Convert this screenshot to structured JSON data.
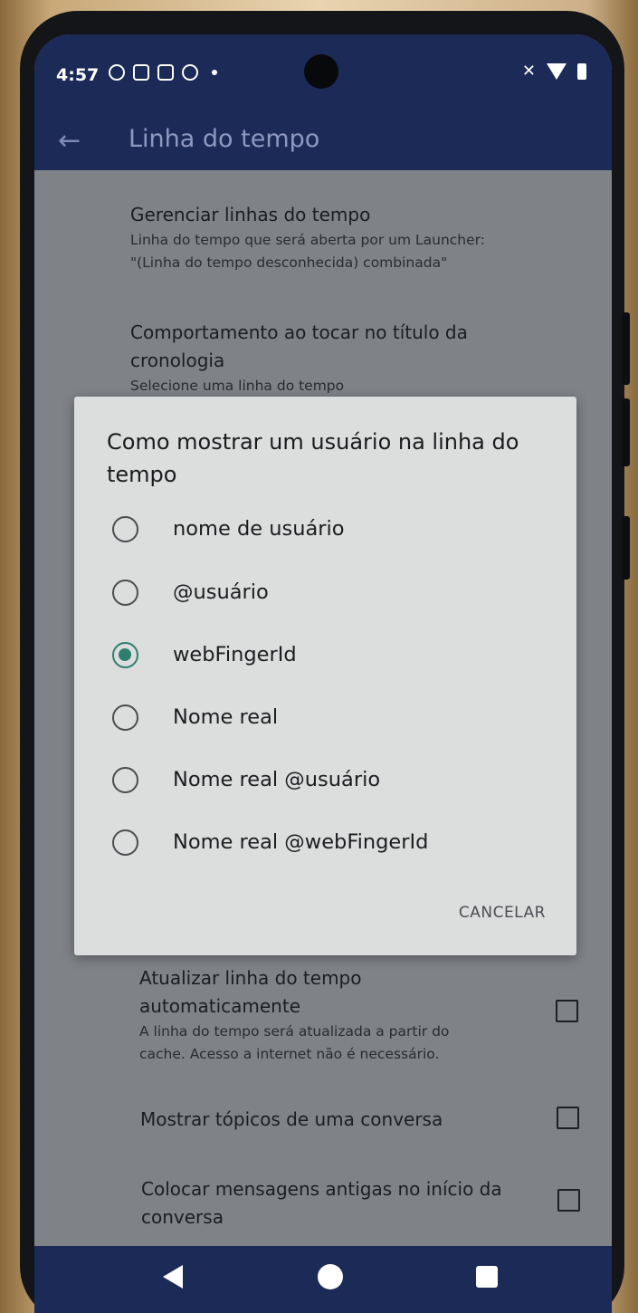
{
  "status_bar": {
    "time": "4:57",
    "icons": [
      "notification-icon",
      "sim-icon",
      "bag-icon",
      "message-icon"
    ],
    "right_icons": [
      "mute-icon",
      "wifi-icon",
      "battery-icon"
    ]
  },
  "app_bar": {
    "title": "Linha do tempo"
  },
  "preferences": [
    {
      "title": "Gerenciar linhas do tempo",
      "summary_lines": [
        "Linha do tempo que será aberta por um Launcher:",
        "\"(Linha do tempo desconhecida) combinada\""
      ]
    },
    {
      "title_lines": [
        "Comportamento ao tocar no título da",
        "cronologia"
      ],
      "summary": "Selecione uma linha do tempo"
    },
    {
      "title_lines": [
        "Atualizar linha do tempo",
        "automaticamente"
      ],
      "summary_lines": [
        "A linha do tempo será atualizada a partir do",
        "cache. Acesso a internet não é necessário."
      ],
      "checked": false
    },
    {
      "title": "Mostrar tópicos de uma conversa",
      "checked": false
    },
    {
      "title_lines": [
        "Colocar mensagens antigas no início da",
        "conversa"
      ],
      "checked": false
    }
  ],
  "dialog": {
    "title_lines": [
      "Como mostrar um usuário na linha do",
      "tempo"
    ],
    "options": [
      {
        "label": "nome de usuário",
        "selected": false
      },
      {
        "label": "@usuário",
        "selected": false
      },
      {
        "label": "webFingerId",
        "selected": true
      },
      {
        "label": "Nome real",
        "selected": false
      },
      {
        "label": "Nome real @usuário",
        "selected": false
      },
      {
        "label": "Nome real @webFingerId",
        "selected": false
      }
    ],
    "cancel_label": "CANCELAR"
  },
  "colors": {
    "app_bar": "#1b2a57",
    "accent": "#2e7e6f",
    "dialog_bg": "#dcdedd"
  }
}
